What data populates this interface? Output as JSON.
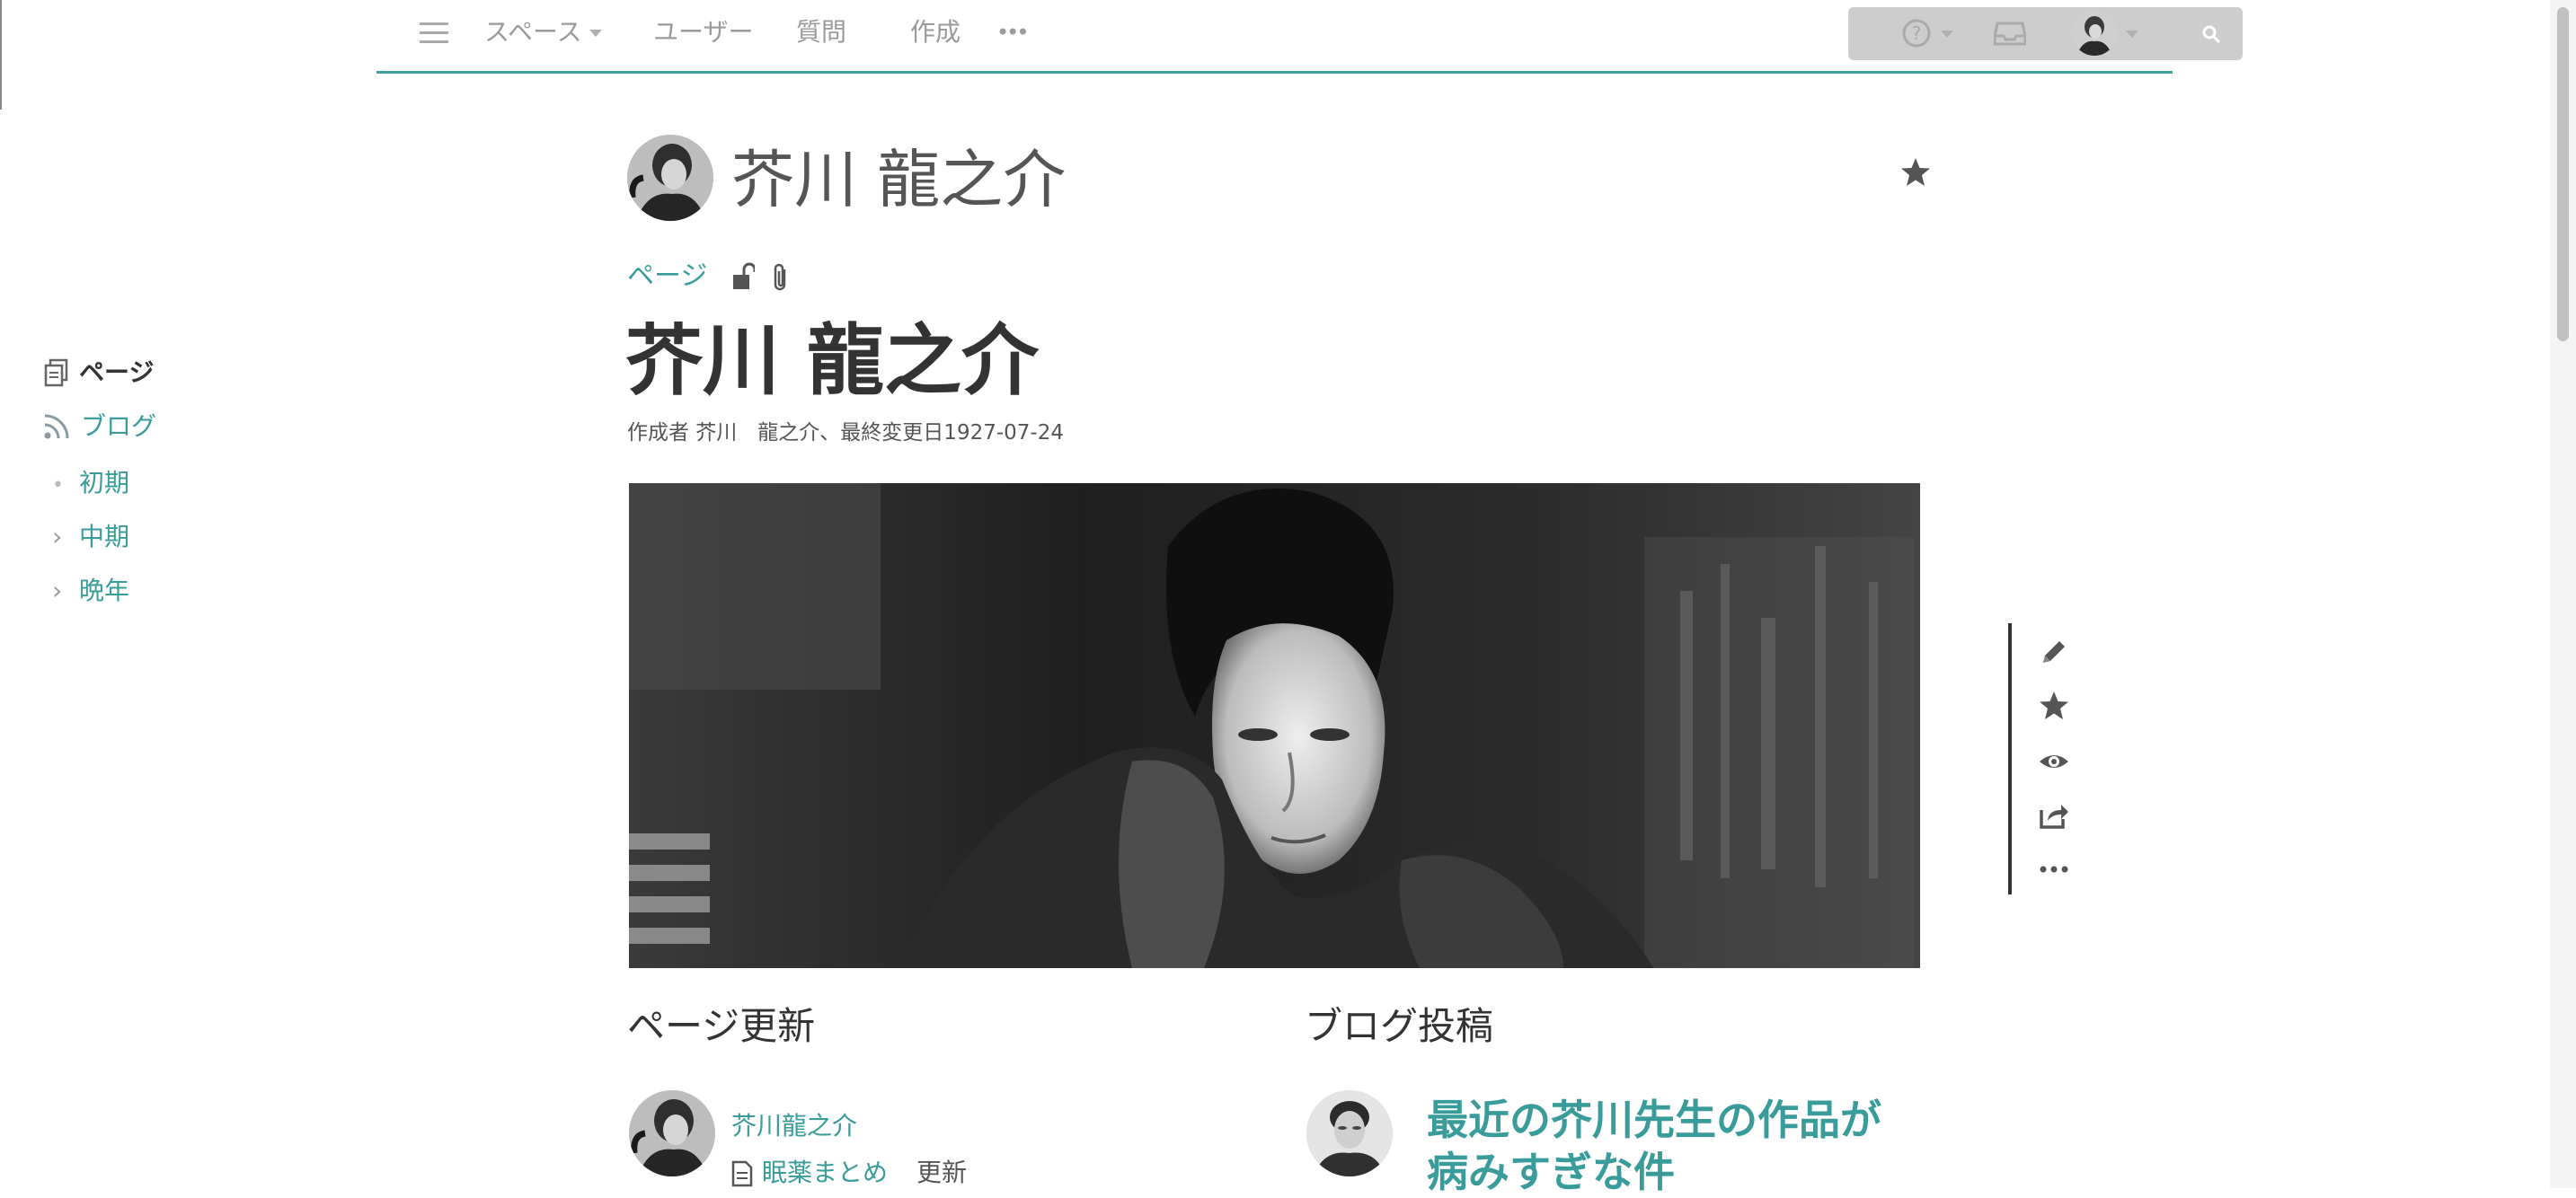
{
  "nav": {
    "spaces": "スペース",
    "users": "ユーザー",
    "questions": "質問",
    "create": "作成",
    "more": "•••",
    "search_value": "",
    "accent": "#3aa5a0"
  },
  "sidebar": {
    "pages": "ページ",
    "blog": "ブログ",
    "tree": [
      {
        "label": "初期",
        "marker": "•"
      },
      {
        "label": "中期",
        "marker": "›"
      },
      {
        "label": "晩年",
        "marker": "›"
      }
    ]
  },
  "space": {
    "name": "芥川 龍之介"
  },
  "page": {
    "breadcrumb": "ページ",
    "title": "芥川 龍之介",
    "byline": "作成者 芥川　龍之介、最終変更日1927-07-24"
  },
  "sections": {
    "page_updates": "ページ更新",
    "blog_posts": "ブログ投稿"
  },
  "updates": [
    {
      "author": "芥川龍之介",
      "page": "眠薬まとめ",
      "action": "更新"
    }
  ],
  "posts": [
    {
      "title_line1": "最近の芥川先生の作品が",
      "title_line2": "病みすぎな件"
    }
  ],
  "icons": {
    "menu": "menu-icon",
    "search": "search-icon",
    "help": "help-icon",
    "inbox": "inbox-icon",
    "star": "star-icon",
    "lock": "unlock-icon",
    "attachment": "paperclip-icon",
    "edit": "pencil-icon",
    "watch": "eye-icon",
    "share": "share-icon",
    "more": "more-icon"
  }
}
